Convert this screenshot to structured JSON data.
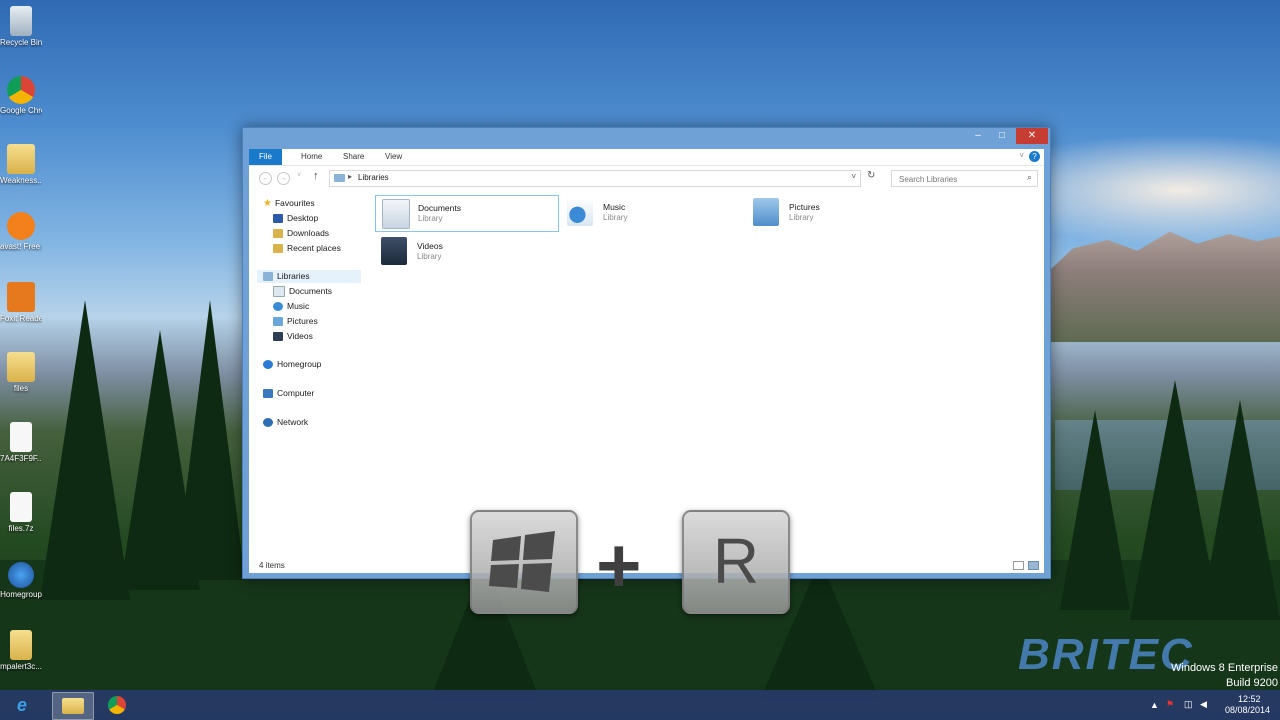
{
  "desktop": {
    "icons": [
      {
        "label": "Recycle Bin"
      },
      {
        "label": "Google Chrome"
      },
      {
        "label": "Weakness... Windows ..."
      },
      {
        "label": "avast! Free Antivirus"
      },
      {
        "label": "Foxit Reader"
      },
      {
        "label": "files"
      },
      {
        "label": "7A4F3F9F..."
      },
      {
        "label": "files.7z"
      },
      {
        "label": "Homegroup"
      },
      {
        "label": "mpalert3c..."
      }
    ]
  },
  "explorer": {
    "ribbon_tabs": [
      "File",
      "Home",
      "Share",
      "View"
    ],
    "address": "Libraries",
    "search_placeholder": "Search Libraries",
    "nav": {
      "favourites": "Favourites",
      "favourite_items": [
        "Desktop",
        "Downloads",
        "Recent places"
      ],
      "libraries": "Libraries",
      "library_items": [
        "Documents",
        "Music",
        "Pictures",
        "Videos"
      ],
      "homegroup": "Homegroup",
      "computer": "Computer",
      "network": "Network"
    },
    "tiles": [
      {
        "name": "Documents",
        "sub": "Library"
      },
      {
        "name": "Music",
        "sub": "Library"
      },
      {
        "name": "Pictures",
        "sub": "Library"
      },
      {
        "name": "Videos",
        "sub": "Library"
      }
    ],
    "status": "4 items"
  },
  "overlay": {
    "key_r": "R",
    "plus": "+",
    "brand": "BRITEC"
  },
  "watermark": {
    "line1": "Windows 8 Enterprise",
    "line2": "Build 9200"
  },
  "taskbar": {
    "time": "12:52",
    "date": "08/08/2014"
  },
  "colors": {
    "accent": "#1979ca",
    "close_button": "#c73c33",
    "window_frame": "#6fa0d6",
    "taskbar": "#263a68"
  }
}
